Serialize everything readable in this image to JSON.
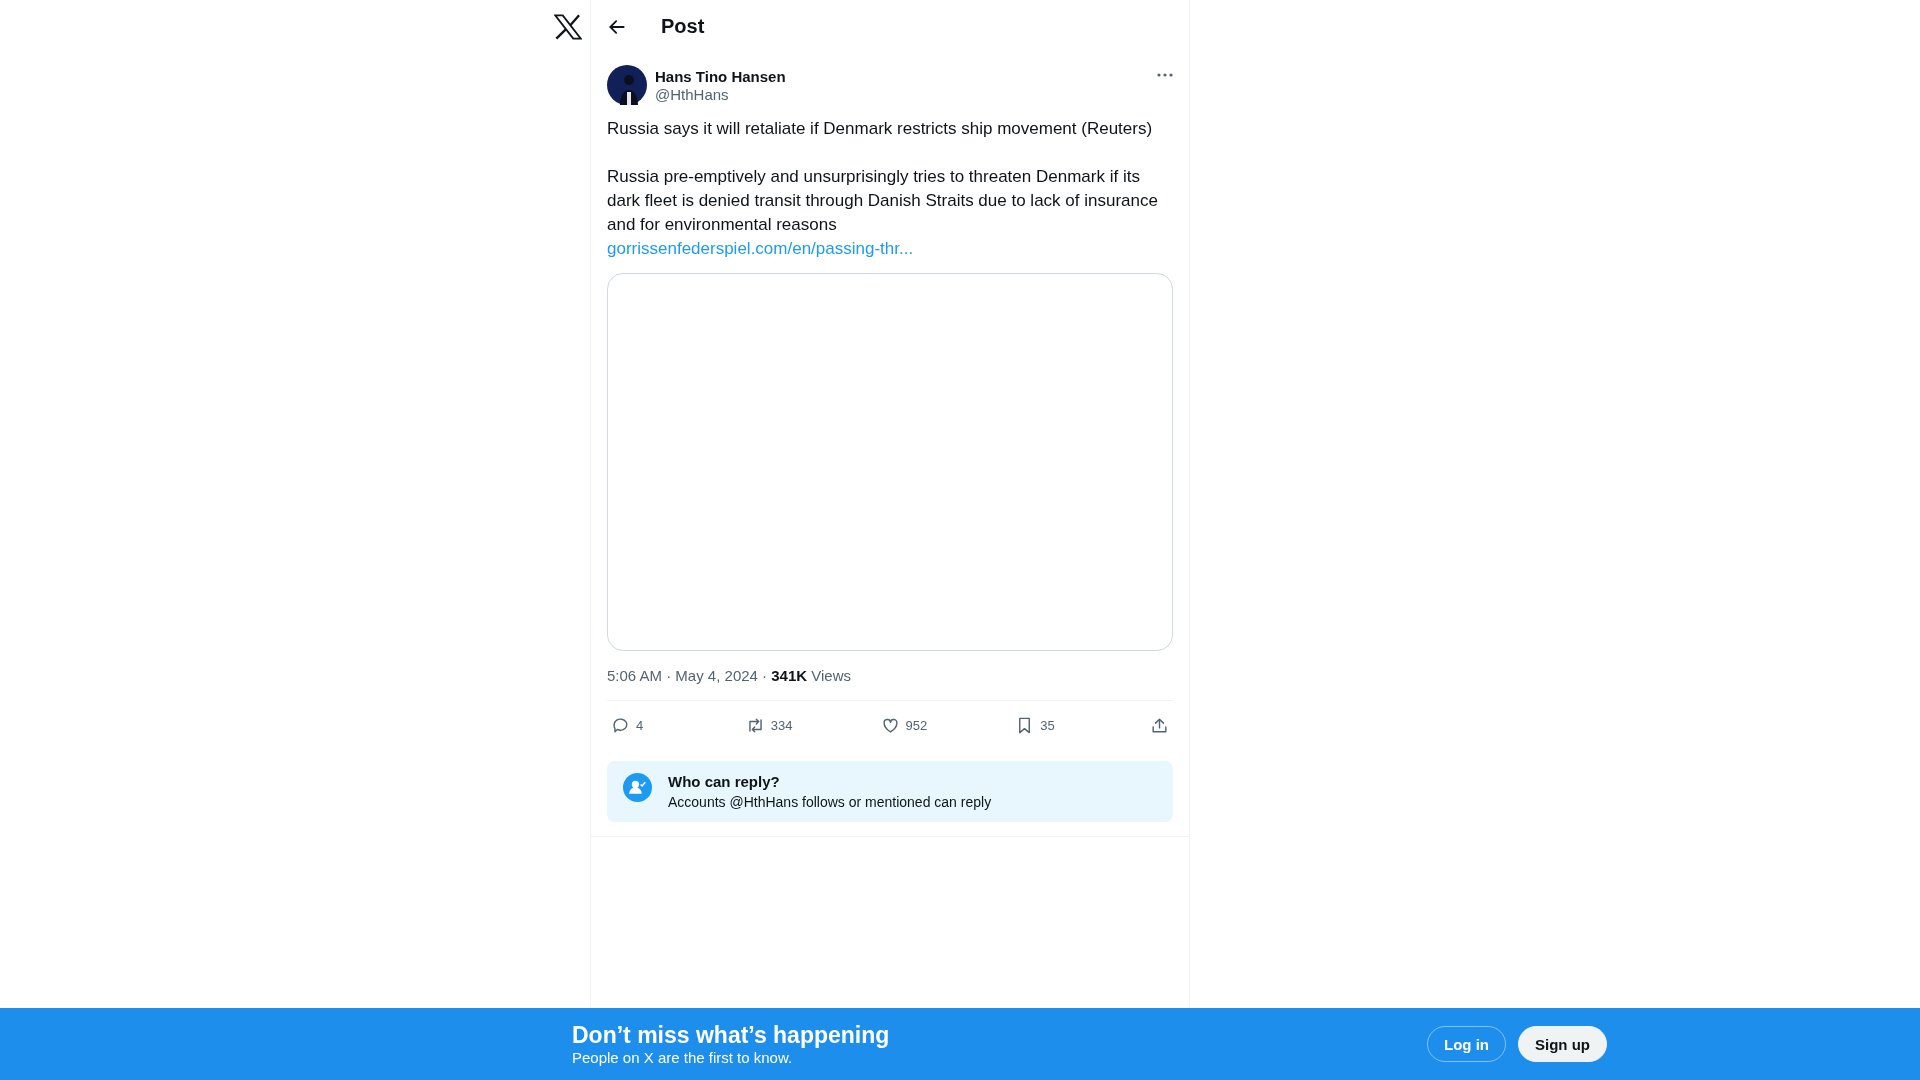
{
  "header": {
    "title": "Post"
  },
  "post": {
    "author": {
      "name": "Hans Tino Hansen",
      "handle": "@HthHans"
    },
    "paragraphs": [
      "Russia says it will retaliate if Denmark restricts ship movement (Reuters)",
      "Russia pre-emptively and unsurprisingly tries to threaten Denmark if its dark fleet is denied transit through Danish Straits due to lack of insurance and for environmental reasons"
    ],
    "link": "gorrissenfederspiel.com/en/passing-thr...",
    "meta": "5:06 AM · May 4, 2024 · **341K** Views",
    "actions": [
      {
        "kind": "reply",
        "count": "4"
      },
      {
        "kind": "repost",
        "count": "334"
      },
      {
        "kind": "like",
        "count": "952"
      },
      {
        "kind": "bookmark",
        "count": "35"
      },
      {
        "kind": "share"
      }
    ],
    "reply_notice": {
      "title": "Who can reply?",
      "text": "Accounts @HthHans follows or mentioned can reply"
    }
  },
  "banner": {
    "title": "Don’t miss what’s happening",
    "subtitle": "People on X are the first to know.",
    "buttons": [
      {
        "kind": "outline",
        "label": "Log in"
      },
      {
        "kind": "solid",
        "label": "Sign up"
      }
    ]
  }
}
